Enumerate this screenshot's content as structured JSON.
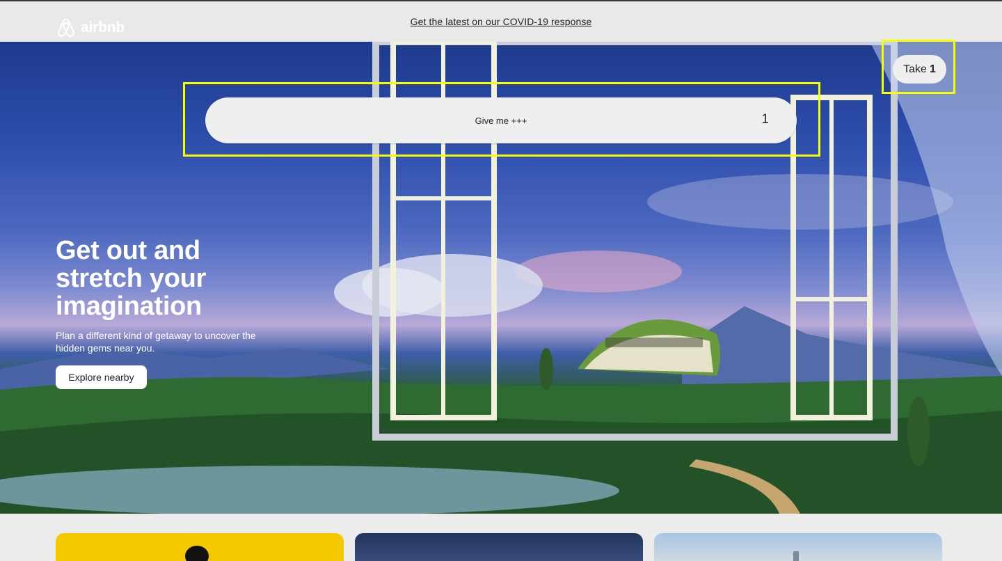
{
  "banner": {
    "link_text": "Get the latest on our COVID-19 response"
  },
  "header": {
    "logo_text": "airbnb",
    "take_button": {
      "label": "Take",
      "count": "1"
    }
  },
  "search": {
    "label": "Give me +++",
    "count": "1"
  },
  "hero": {
    "headline": "Get out and stretch your imagination",
    "subtitle": "Plan a different kind of getaway to uncover the hidden gems near you.",
    "cta_label": "Explore nearby"
  },
  "colors": {
    "highlight": "#f5ff00",
    "button_bg": "#efefef",
    "card_yellow": "#f5c800"
  }
}
